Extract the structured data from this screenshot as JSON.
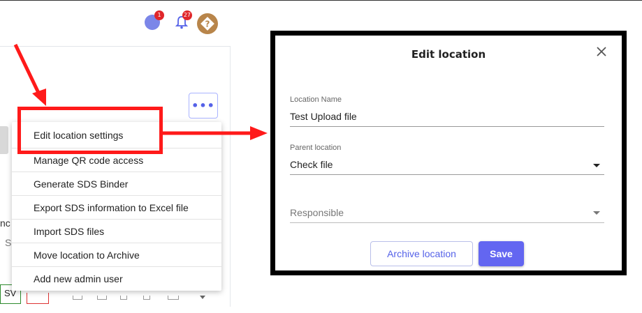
{
  "header": {
    "notes_badge": "1",
    "bell_badge": "27"
  },
  "background": {
    "cut_text_1": "nc",
    "cut_text_2": "S",
    "sw_label": "SV"
  },
  "menu": {
    "items": [
      {
        "label": "Edit location settings"
      },
      {
        "label": "Manage QR code access"
      },
      {
        "label": "Generate SDS Binder"
      },
      {
        "label": "Export SDS information to Excel file"
      },
      {
        "label": "Import SDS files"
      },
      {
        "label": "Move location to Archive"
      },
      {
        "label": "Add new admin user"
      }
    ]
  },
  "modal": {
    "title": "Edit location",
    "location_name_label": "Location Name",
    "location_name_value": "Test Upload file",
    "parent_location_label": "Parent location",
    "parent_location_value": "Check file",
    "responsible_placeholder": "Responsible",
    "archive_button": "Archive location",
    "save_button": "Save"
  },
  "colors": {
    "annotation_red": "#ff1a1a",
    "primary": "#6366f1",
    "badge": "#e0262a",
    "help_icon": "#b8854a"
  }
}
